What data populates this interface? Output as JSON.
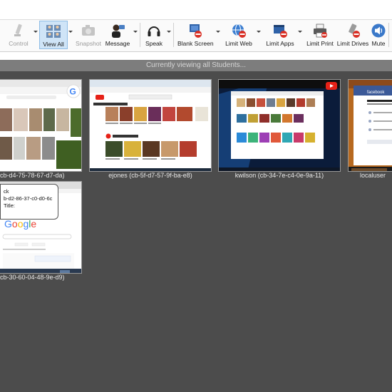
{
  "toolbar": {
    "items": [
      {
        "label": "Control",
        "icon": "control-icon",
        "enabled": false
      },
      {
        "label": "View All",
        "icon": "view-all-icon",
        "enabled": true,
        "active": true
      },
      {
        "label": "Snapshot",
        "icon": "snapshot-icon",
        "enabled": false
      },
      {
        "label": "Message",
        "icon": "message-icon",
        "enabled": true
      },
      {
        "label": "Speak",
        "icon": "speak-icon",
        "enabled": true
      },
      {
        "label": "Blank Screen",
        "icon": "blank-screen-icon",
        "enabled": true
      },
      {
        "label": "Limit Web",
        "icon": "limit-web-icon",
        "enabled": true
      },
      {
        "label": "Limit Apps",
        "icon": "limit-apps-icon",
        "enabled": true
      },
      {
        "label": "Limit Print",
        "icon": "limit-print-icon",
        "enabled": true
      },
      {
        "label": "Limit Drives",
        "icon": "limit-drives-icon",
        "enabled": true
      },
      {
        "label": "Mute",
        "icon": "mute-icon",
        "enabled": true
      }
    ]
  },
  "status_text": "Currently viewing all Students...",
  "thumbnails": [
    {
      "label": "cb-d4-75-78-67-d7-da)",
      "content": "google-image-search"
    },
    {
      "label": "ejones (cb-5f-d7-57-9f-ba-e8)",
      "content": "youtube-home"
    },
    {
      "label": "kwilson (cb-34-7e-c4-0e-9a-11)",
      "content": "youtube-dark"
    },
    {
      "label": "localuser",
      "content": "facebook-login"
    },
    {
      "label": "cb-30-60-04-48-9e-d9)",
      "content": "google-search"
    }
  ],
  "tooltip": {
    "line1": "ck",
    "line2": "b-d2-86-37-c0-d0-6c",
    "line3": "Title:"
  },
  "colors": {
    "main_bg": "#4c4c4c",
    "status_bar_bg": "#7d7d7d",
    "active_tool_bg": "#cfe4f7",
    "youtube_red": "#e62117",
    "facebook_blue": "#3b5998"
  }
}
